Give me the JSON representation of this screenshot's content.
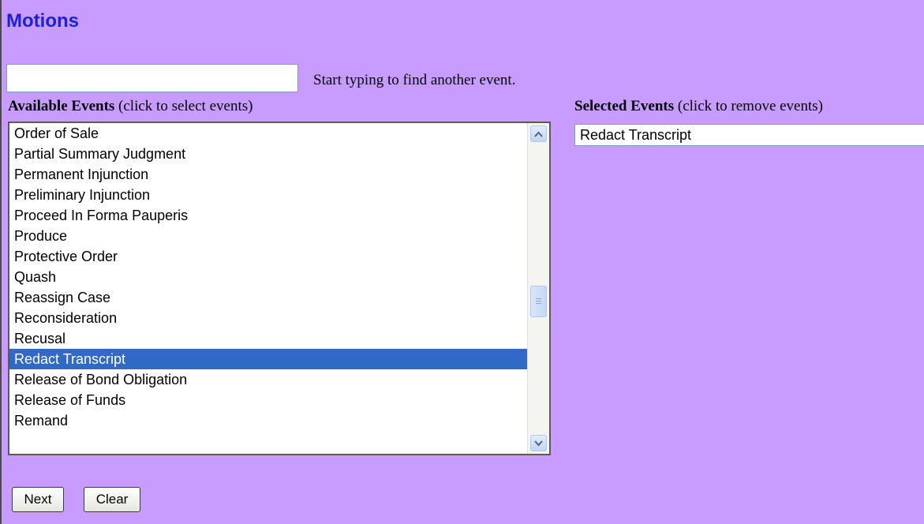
{
  "page": {
    "title": "Motions"
  },
  "search": {
    "value": "",
    "placeholder": "",
    "hint": "Start typing to find another event."
  },
  "available": {
    "heading_bold": "Available Events",
    "heading_note": "(click to select events)",
    "items": [
      {
        "label": "Order of Sale",
        "selected": false
      },
      {
        "label": "Partial Summary Judgment",
        "selected": false
      },
      {
        "label": "Permanent Injunction",
        "selected": false
      },
      {
        "label": "Preliminary Injunction",
        "selected": false
      },
      {
        "label": "Proceed In Forma Pauperis",
        "selected": false
      },
      {
        "label": "Produce",
        "selected": false
      },
      {
        "label": "Protective Order",
        "selected": false
      },
      {
        "label": "Quash",
        "selected": false
      },
      {
        "label": "Reassign Case",
        "selected": false
      },
      {
        "label": "Reconsideration",
        "selected": false
      },
      {
        "label": "Recusal",
        "selected": false
      },
      {
        "label": "Redact Transcript",
        "selected": true
      },
      {
        "label": "Release of Bond Obligation",
        "selected": false
      },
      {
        "label": "Release of Funds",
        "selected": false
      },
      {
        "label": "Remand",
        "selected": false
      }
    ],
    "scroll_position": 0.55
  },
  "selected": {
    "heading_bold": "Selected Events",
    "heading_note": "(click to remove events)",
    "items": [
      {
        "label": "Redact Transcript"
      }
    ]
  },
  "buttons": {
    "next_label": "Next",
    "clear_label": "Clear"
  },
  "colors": {
    "background": "#c89bff",
    "title": "#1a21d6",
    "selection": "#3169c6"
  },
  "icons": {
    "scroll_up": "chevron-up-icon",
    "scroll_down": "chevron-down-icon",
    "scroll_grip": "grip-icon"
  }
}
